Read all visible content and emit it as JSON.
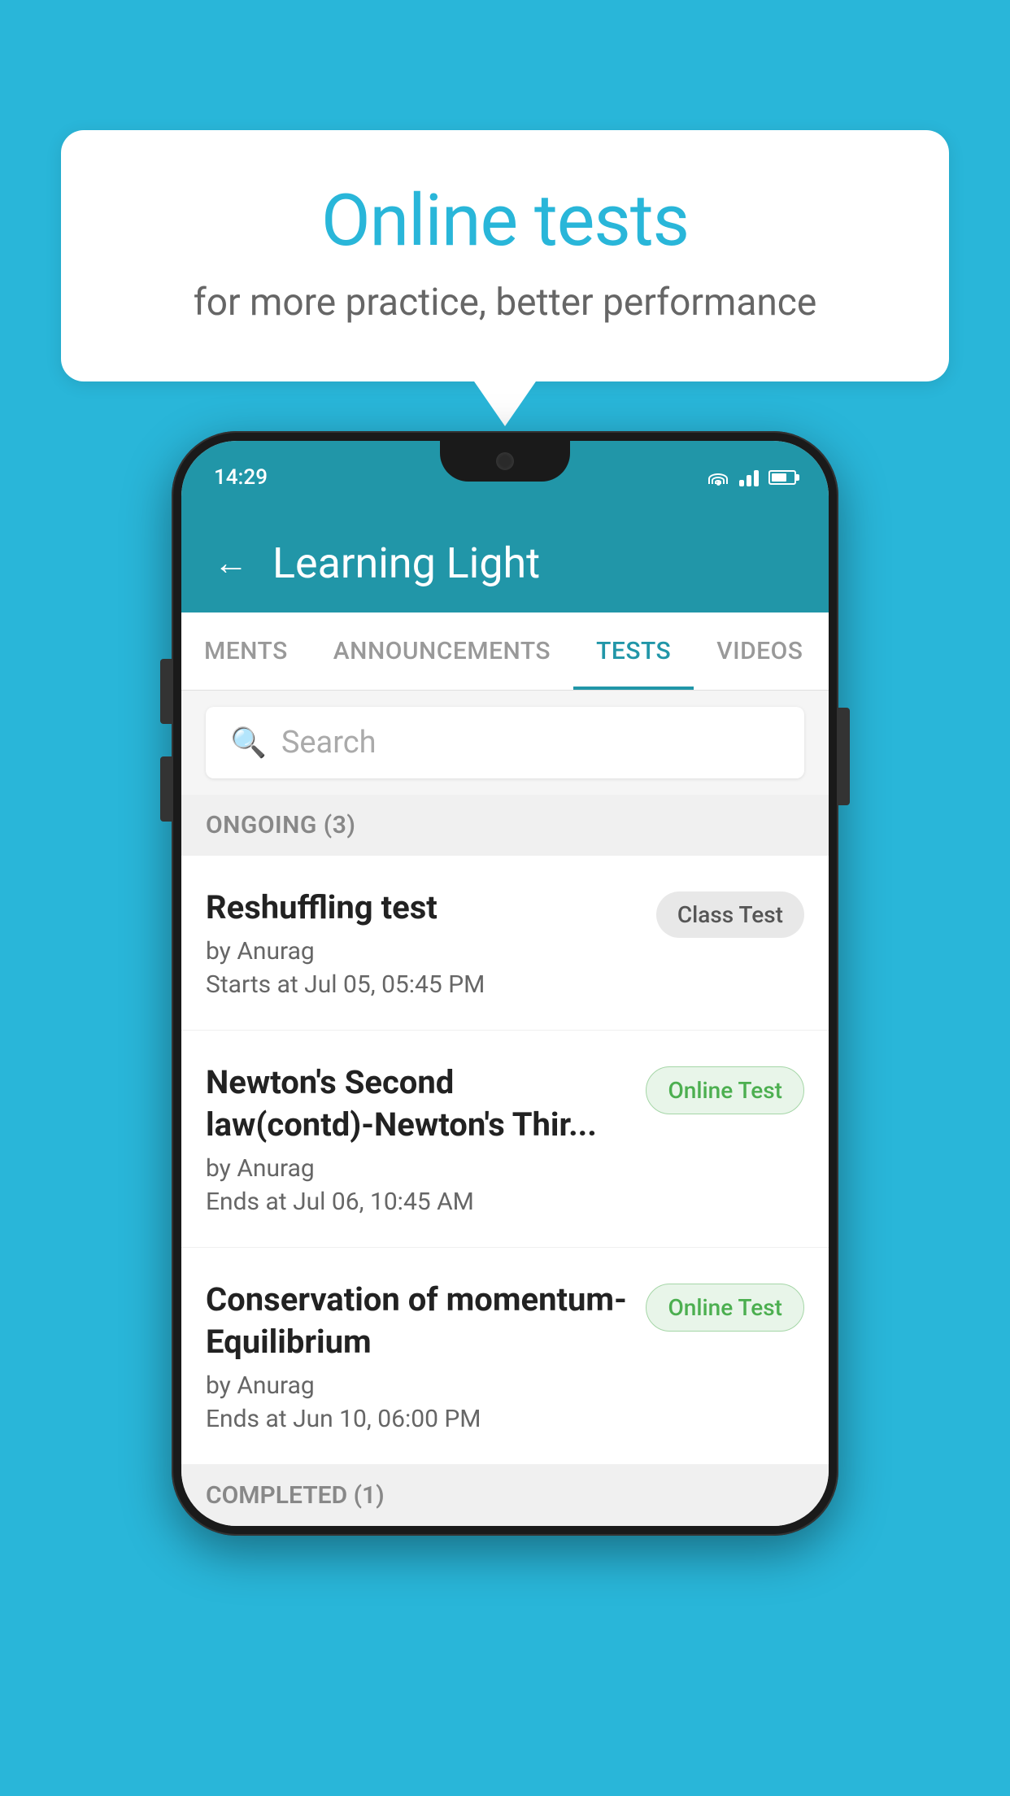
{
  "background_color": "#29B6D9",
  "speech_bubble": {
    "title": "Online tests",
    "subtitle": "for more practice, better performance"
  },
  "phone": {
    "status_bar": {
      "time": "14:29"
    },
    "app_bar": {
      "title": "Learning Light"
    },
    "tabs": [
      {
        "label": "MENTS",
        "active": false
      },
      {
        "label": "ANNOUNCEMENTS",
        "active": false
      },
      {
        "label": "TESTS",
        "active": true
      },
      {
        "label": "VIDEOS",
        "active": false
      }
    ],
    "search": {
      "placeholder": "Search"
    },
    "sections": [
      {
        "header": "ONGOING (3)",
        "tests": [
          {
            "name": "Reshuffling test",
            "author": "by Anurag",
            "time_label": "Starts at",
            "time": "Jul 05, 05:45 PM",
            "badge": "Class Test",
            "badge_type": "class"
          },
          {
            "name": "Newton's Second law(contd)-Newton's Thir...",
            "author": "by Anurag",
            "time_label": "Ends at",
            "time": "Jul 06, 10:45 AM",
            "badge": "Online Test",
            "badge_type": "online"
          },
          {
            "name": "Conservation of momentum-Equilibrium",
            "author": "by Anurag",
            "time_label": "Ends at",
            "time": "Jun 10, 06:00 PM",
            "badge": "Online Test",
            "badge_type": "online"
          }
        ]
      }
    ],
    "completed_header": "COMPLETED (1)"
  }
}
